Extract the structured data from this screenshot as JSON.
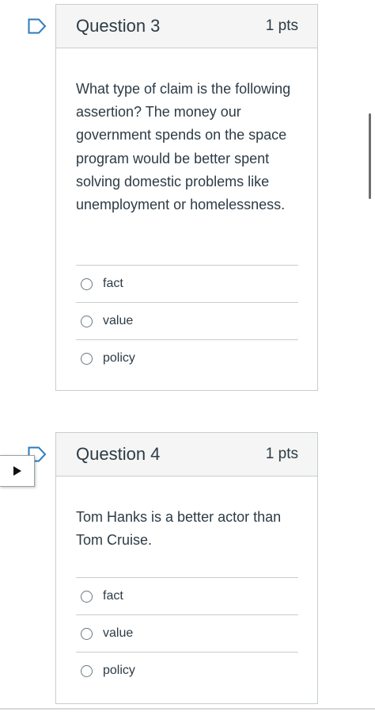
{
  "questions": [
    {
      "title": "Question 3",
      "points": "1 pts",
      "text": "What type of claim is the following assertion? The money our government spends on the space program would be better spent solving domestic problems like unemployment or homelessness.",
      "answers": [
        "fact",
        "value",
        "policy"
      ]
    },
    {
      "title": "Question 4",
      "points": "1 pts",
      "text": "Tom Hanks is a better actor than Tom Cruise.",
      "answers": [
        "fact",
        "value",
        "policy"
      ]
    }
  ],
  "colors": {
    "border": "#c7cdd1",
    "header_bg": "#f5f5f5",
    "flag": "#2b7abc",
    "text": "#2d3b45"
  },
  "icons": {
    "flag": "bookmark-flag-icon",
    "play": "play-triangle-icon",
    "radio": "radio-circle-icon"
  }
}
